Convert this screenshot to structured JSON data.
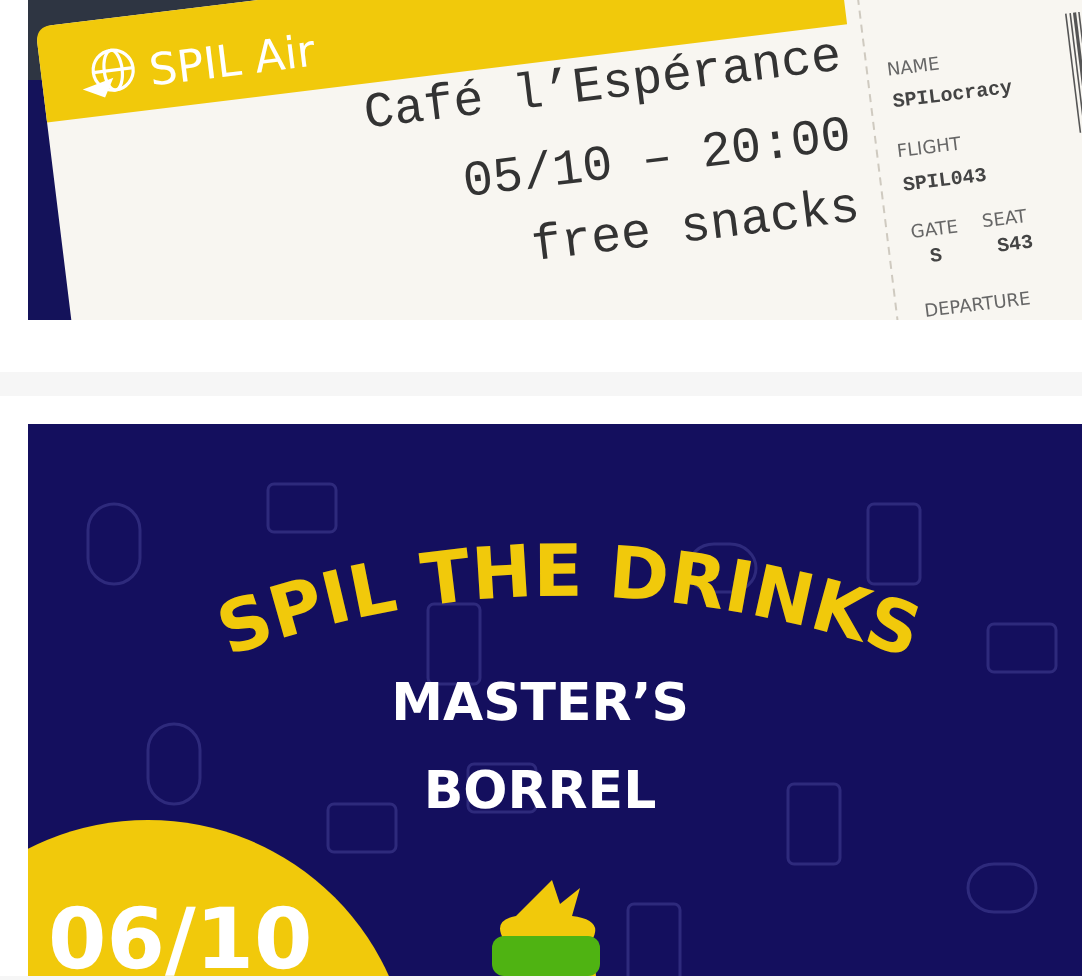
{
  "posts": [
    {
      "kind": "ticket",
      "airline": "SPIL Air",
      "lines": [
        "Café l’Espérance",
        "05/10 – 20:00",
        "free snacks"
      ],
      "fields": [
        {
          "label": "NAME",
          "value": "SPILocracy"
        },
        {
          "label": "FLIGHT",
          "value": "SPIL043"
        },
        {
          "label": "GATE",
          "value": "S"
        },
        {
          "label": "SEAT",
          "value": "S43"
        },
        {
          "label": "DEPARTURE"
        }
      ]
    },
    {
      "kind": "poster",
      "title": "SPIL THE DRINKS",
      "subtitle_lines": [
        "MASTER’S",
        "BORREL"
      ],
      "date": "06/10"
    }
  ]
}
